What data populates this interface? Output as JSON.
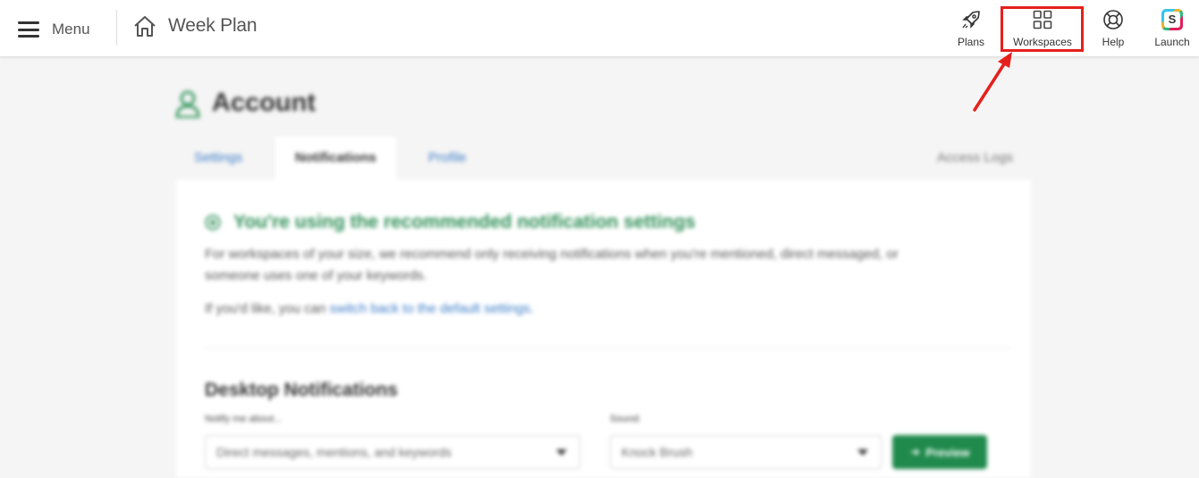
{
  "topbar": {
    "menu_label": "Menu",
    "title": "Week Plan",
    "nav": [
      {
        "label": "Plans",
        "icon": "rocket-icon"
      },
      {
        "label": "Workspaces",
        "icon": "grid-icon"
      },
      {
        "label": "Help",
        "icon": "lifebuoy-icon"
      },
      {
        "label": "Launch",
        "icon": "slack-icon",
        "glyph": "S"
      }
    ]
  },
  "account": {
    "title": "Account",
    "tabs": {
      "settings": "Settings",
      "notifications": "Notifications",
      "profile": "Profile",
      "access_logs": "Access Logs"
    },
    "recommended": {
      "title": "You're using the recommended notification settings",
      "description": "For workspaces of your size, we recommend only receiving notifications when you're mentioned, direct messaged, or someone uses one of your keywords.",
      "switch_prefix": "If you'd like, you can ",
      "switch_link": "switch back to the default settings."
    },
    "desktop": {
      "title": "Desktop Notifications",
      "notify_label": "Notify me about...",
      "notify_value": "Direct messages, mentions, and keywords",
      "sound_label": "Sound:",
      "sound_value": "Knock Brush",
      "preview_label": "Preview"
    }
  },
  "colors": {
    "highlight": "#e5201c",
    "green": "#2f8f57",
    "link": "#3a7bc8",
    "button_green": "#1f8a4c"
  }
}
